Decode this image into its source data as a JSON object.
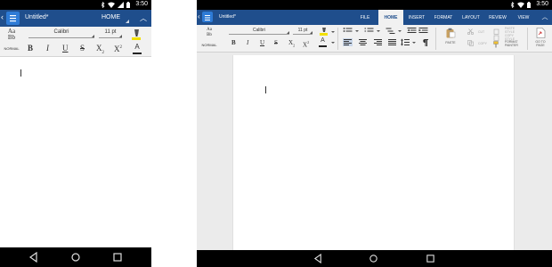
{
  "phone": {
    "status_time": "3:50",
    "doc_title": "Untitled*",
    "tab_selected": "HOME",
    "style_preview": "Aa\nBb",
    "style_name": "NORMAL",
    "font_name": "Calibri",
    "font_size": "11 pt"
  },
  "tablet": {
    "status_time": "3:50",
    "doc_title": "Untitled*",
    "tabs": [
      "FILE",
      "HOME",
      "INSERT",
      "FORMAT",
      "LAYOUT",
      "REVIEW",
      "VIEW"
    ],
    "active_tab": "HOME",
    "style_preview": "Aa\nBb",
    "style_name": "NORMAL",
    "font_name": "Calibri",
    "font_size": "11 pt",
    "paste_label": "PASTE",
    "cut_label": "CUT",
    "copy_label": "COPY",
    "paste_style_label": "PASTE STYLE",
    "copy_style_label": "COPY STYLE",
    "format_painter_label": "FORMAT PAINTER",
    "goto_label": "GO TO PAGE"
  },
  "colors": {
    "app_bar": "#1f4e8c",
    "ribbon": "#f1f1f1",
    "doc_icon": "#2e7bd6",
    "highlight": "#f2e000",
    "selected_align": "#c9d7ea"
  }
}
